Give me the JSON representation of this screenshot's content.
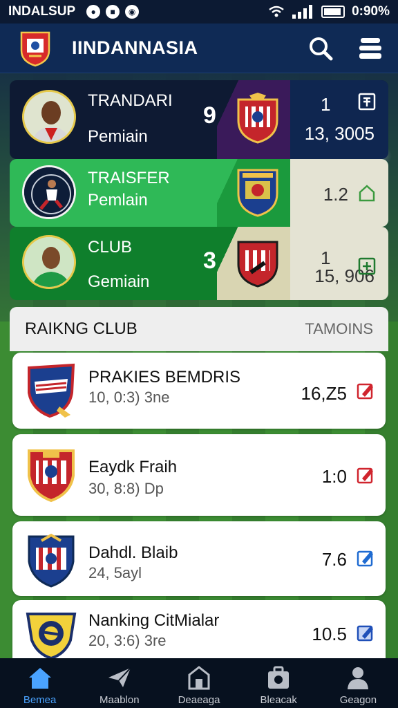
{
  "status_bar": {
    "carrier": "INDALSUP",
    "time": "0:90%"
  },
  "header": {
    "title": "IINDANNASIA",
    "search_icon": "search-icon",
    "menu_icon": "menu-icon"
  },
  "hero_cards": [
    {
      "title": "TRANDARI",
      "subtitle": "Pemiain",
      "big_number": "9",
      "right_top": "1",
      "right_value": "13, 3005",
      "icon": "grid-box-icon"
    },
    {
      "title": "TRAISFER",
      "subtitle": "Pemlain",
      "big_number": "",
      "right_top": "",
      "right_value": "1.2",
      "icon": "house-outline-icon"
    },
    {
      "title": "CLUB",
      "subtitle": "Gemiain",
      "big_number": "3",
      "right_top": "1",
      "right_value": "15, 906",
      "icon": "plus-box-icon"
    }
  ],
  "ranking": {
    "title": "RAIKNG CLUB",
    "action": "TAMOINS",
    "rows": [
      {
        "name": "PRAKIES BEMDRIS",
        "detail": "10, 0:3) 3ne",
        "score": "16,Z5",
        "edit_color": "#d0252e"
      },
      {
        "name": "Eaydk Fraih",
        "detail": "30, 8:8) Dp",
        "score": "1:0",
        "edit_color": "#d0252e"
      },
      {
        "name": "Dahdl. Blaib",
        "detail": "24, 5ayl",
        "score": "7.6",
        "edit_color": "#1f6bd1"
      },
      {
        "name": "Nanking CitMialar",
        "detail": "20, 3:6) 3re",
        "score": "10.5",
        "edit_color": "#1f4fb8"
      }
    ]
  },
  "bottom_nav": [
    {
      "label": "Bemea",
      "icon": "home-icon",
      "active": true
    },
    {
      "label": "Maablon",
      "icon": "paper-plane-icon",
      "active": false
    },
    {
      "label": "Deaeaga",
      "icon": "store-icon",
      "active": false
    },
    {
      "label": "Bleacak",
      "icon": "camera-bag-icon",
      "active": false
    },
    {
      "label": "Geagon",
      "icon": "person-icon",
      "active": false
    }
  ],
  "colors": {
    "accent_blue": "#4aa3ff",
    "header_bg": "#0f2a55",
    "card_green": "#2fb957",
    "edit_red": "#d0252e"
  }
}
